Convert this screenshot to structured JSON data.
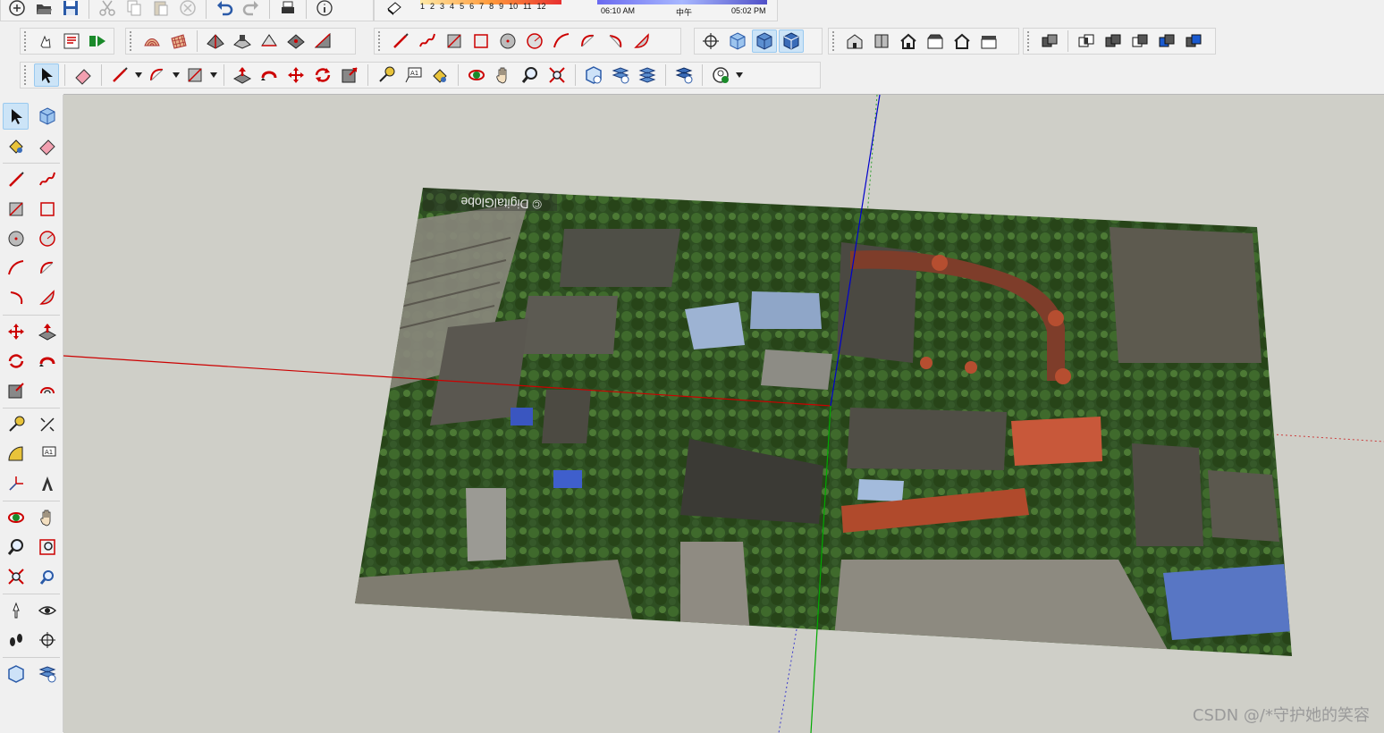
{
  "shadow_settings": {
    "months": [
      "1",
      "2",
      "3",
      "4",
      "5",
      "6",
      "7",
      "8",
      "9",
      "10",
      "11",
      "12"
    ],
    "time_start": "06:10 AM",
    "time_mid": "中午",
    "time_end": "05:02 PM"
  },
  "imagery": {
    "credit": "© DigitalGlobe"
  },
  "watermark": "CSDN @/*守护她的笑容",
  "colors": {
    "active_tool": "#cce4f7",
    "axis_red": "#cc0000",
    "axis_green": "#00aa00",
    "axis_blue": "#0000cc",
    "viewport_bg": "#cfcfc8"
  },
  "icons": {
    "standard": [
      "new-icon",
      "open-icon",
      "save-icon",
      "cut-icon",
      "copy-icon",
      "paste-icon",
      "erase-selection-icon",
      "undo-icon",
      "redo-icon",
      "print-icon",
      "model-info-icon"
    ],
    "styles": [
      "xray-icon",
      "back-edges-icon",
      "wireframe-icon",
      "hidden-line-icon",
      "shaded-icon",
      "shaded-textures-icon",
      "monochrome-icon"
    ],
    "views": [
      "iso-icon",
      "top-icon",
      "front-icon",
      "right-icon",
      "back-icon",
      "left-icon"
    ],
    "layers": [
      "camera-icon"
    ]
  }
}
